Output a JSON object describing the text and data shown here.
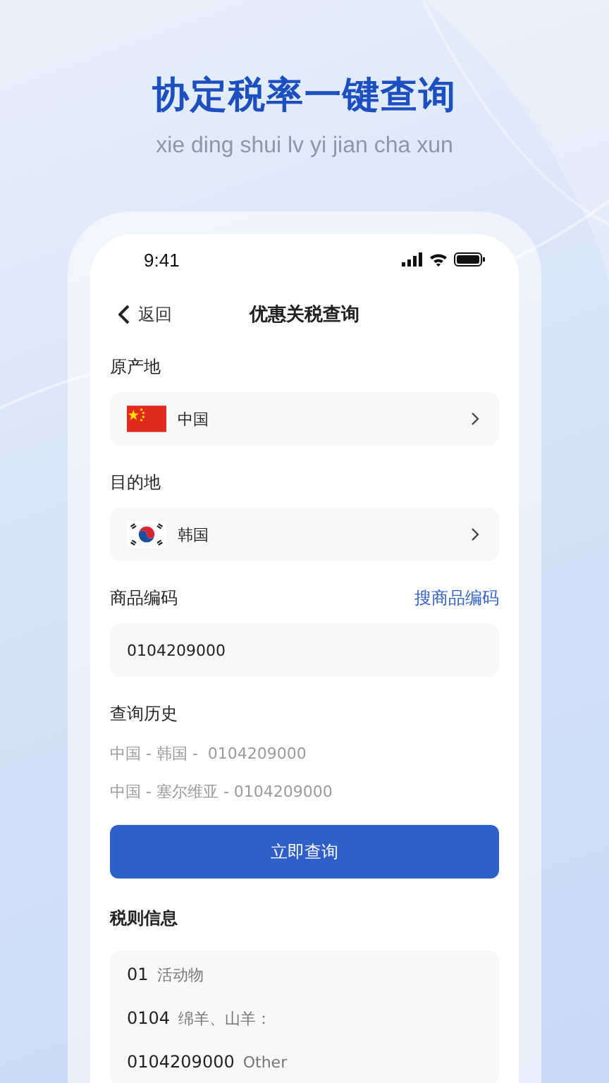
{
  "promo": {
    "title": "协定税率一键查询",
    "subtitle": "xie ding shui lv yi jian cha xun"
  },
  "status_bar": {
    "time": "9:41"
  },
  "nav": {
    "back": "返回",
    "title": "优惠关税查询"
  },
  "places": [
    {
      "label": "原产地",
      "value": "中国",
      "kind": "china"
    },
    {
      "label": "目的地",
      "value": "韩国",
      "kind": "korea"
    }
  ],
  "code": {
    "label": "商品编码",
    "link": "搜商品编码",
    "value": "0104209000"
  },
  "history": {
    "label": "查询历史",
    "items": [
      "中国 - 韩国 -  0104209000",
      "中国 - 塞尔维亚 - 0104209000"
    ]
  },
  "button": "立即查询",
  "rules": {
    "label": "税则信息",
    "items": [
      {
        "code": "01",
        "text": "活动物"
      },
      {
        "code": "0104",
        "text": "绵羊、山羊："
      },
      {
        "code": "0104209000",
        "text": "Other"
      }
    ]
  }
}
